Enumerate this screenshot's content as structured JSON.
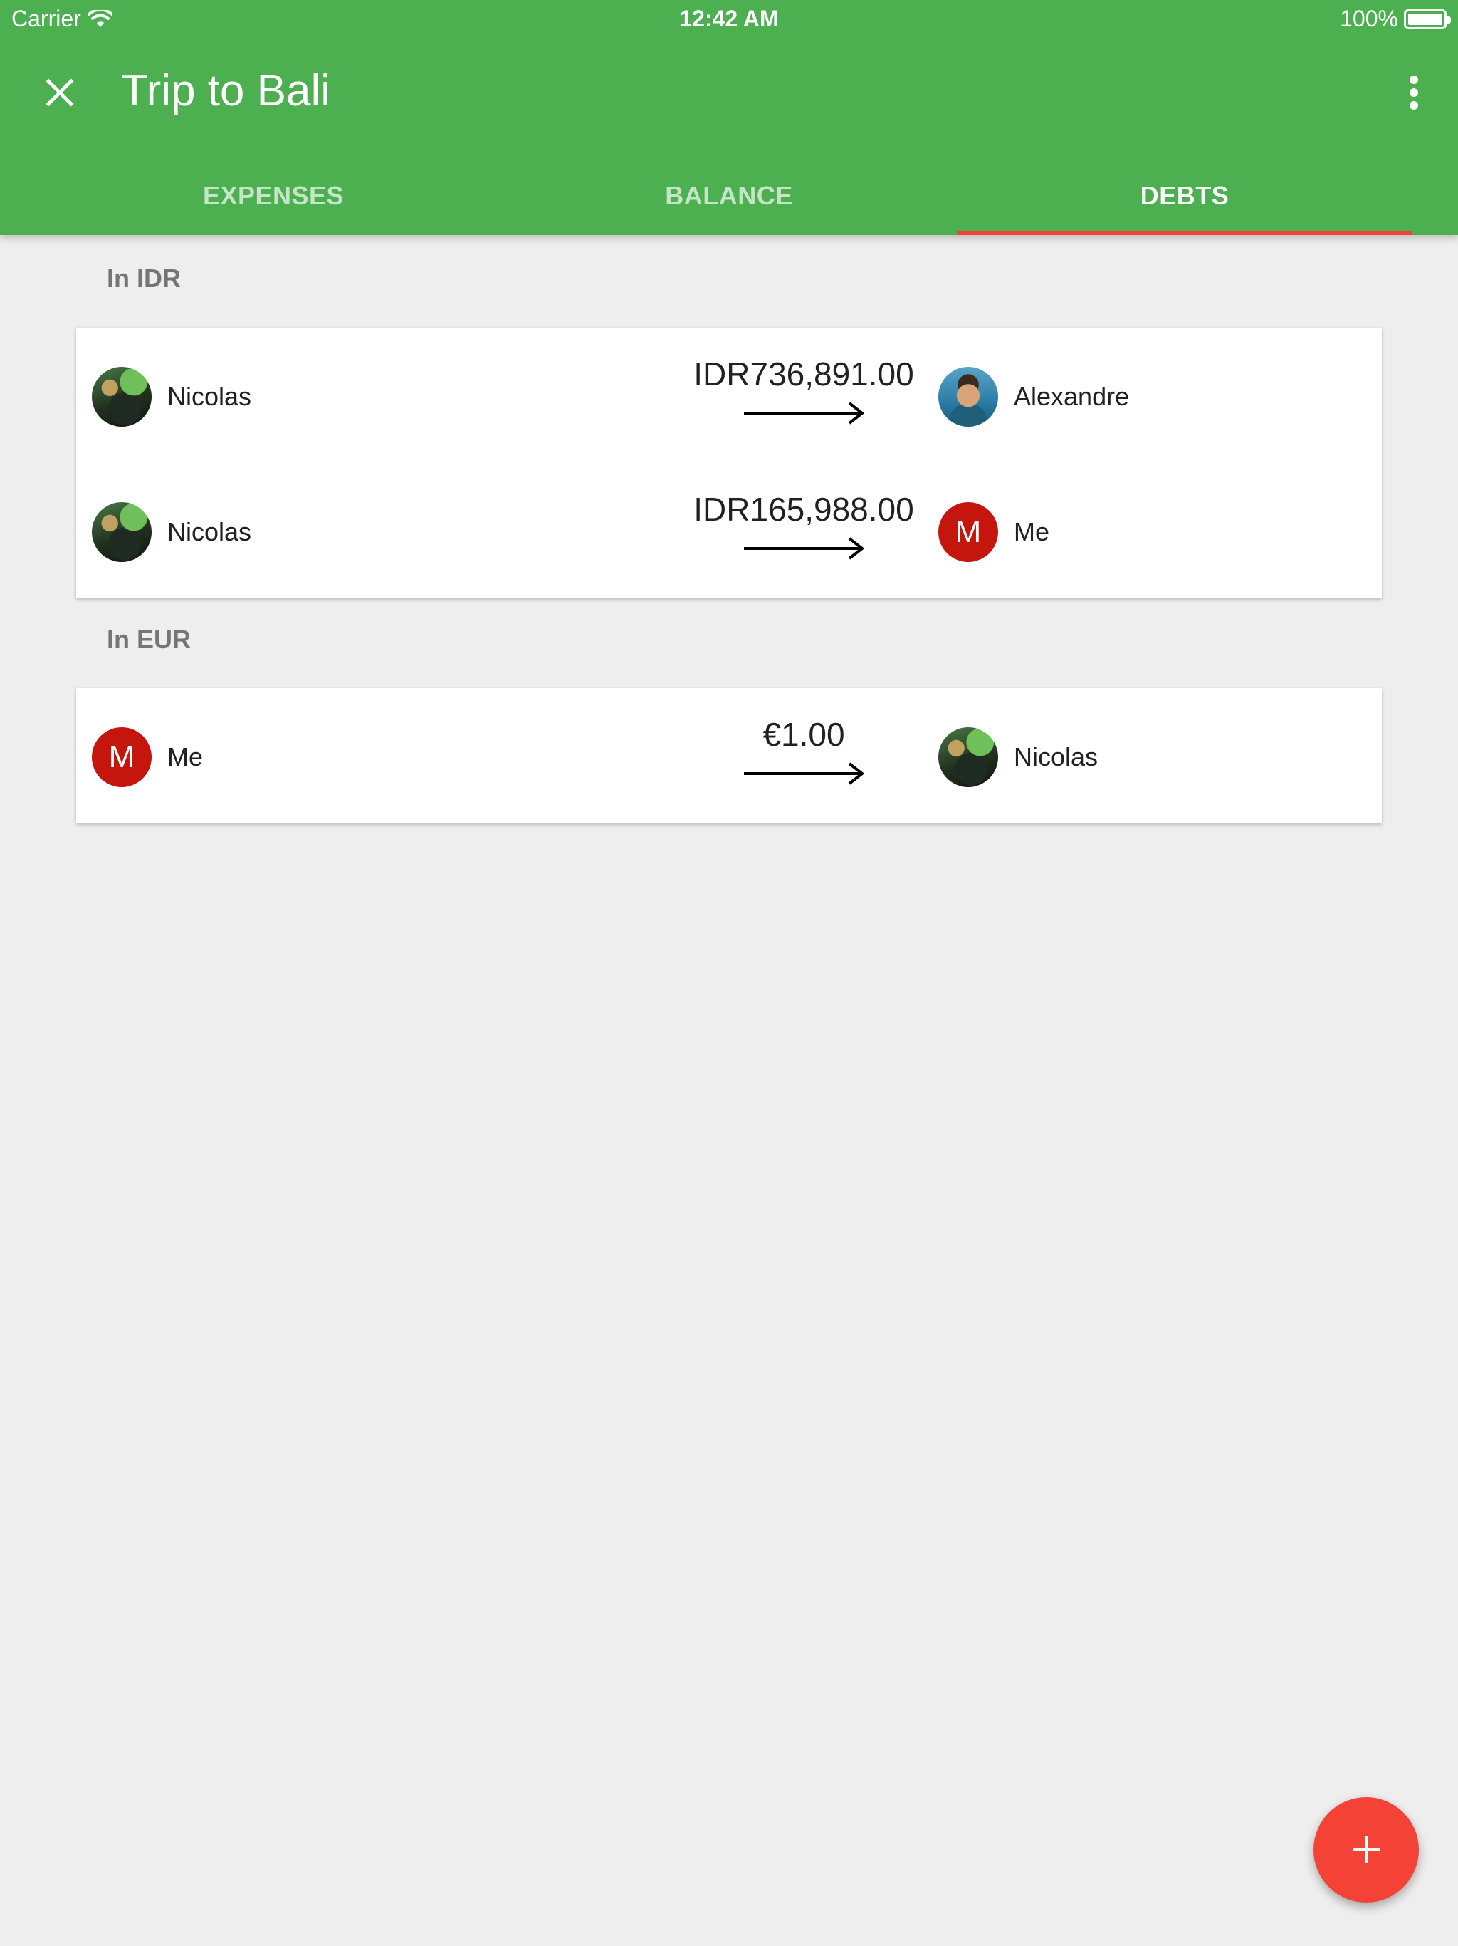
{
  "status_bar": {
    "carrier": "Carrier",
    "time": "12:42 AM",
    "battery": "100%",
    "battery_level": 1.0
  },
  "toolbar": {
    "title": "Trip to Bali",
    "close_icon": "close-icon",
    "overflow_icon": "more-vert-icon"
  },
  "tabs": [
    {
      "label": "EXPENSES",
      "active": false
    },
    {
      "label": "BALANCE",
      "active": false
    },
    {
      "label": "DEBTS",
      "active": true
    }
  ],
  "sections": [
    {
      "label": "In IDR",
      "debts": [
        {
          "from": {
            "name": "Nicolas",
            "avatar": "photo"
          },
          "amount": "IDR736,891.00",
          "to": {
            "name": "Alexandre",
            "avatar": "photo"
          }
        },
        {
          "from": {
            "name": "Nicolas",
            "avatar": "photo"
          },
          "amount": "IDR165,988.00",
          "to": {
            "name": "Me",
            "avatar": "M"
          }
        }
      ]
    },
    {
      "label": "In EUR",
      "debts": [
        {
          "from": {
            "name": "Me",
            "avatar": "M"
          },
          "amount": "€1.00",
          "to": {
            "name": "Nicolas",
            "avatar": "photo"
          }
        }
      ]
    }
  ],
  "fab": {
    "icon": "add-icon"
  },
  "colors": {
    "primary": "#4caf50",
    "accent": "#f44336",
    "avatar_letter_bg": "#c4160d",
    "background": "#eeeeee"
  }
}
